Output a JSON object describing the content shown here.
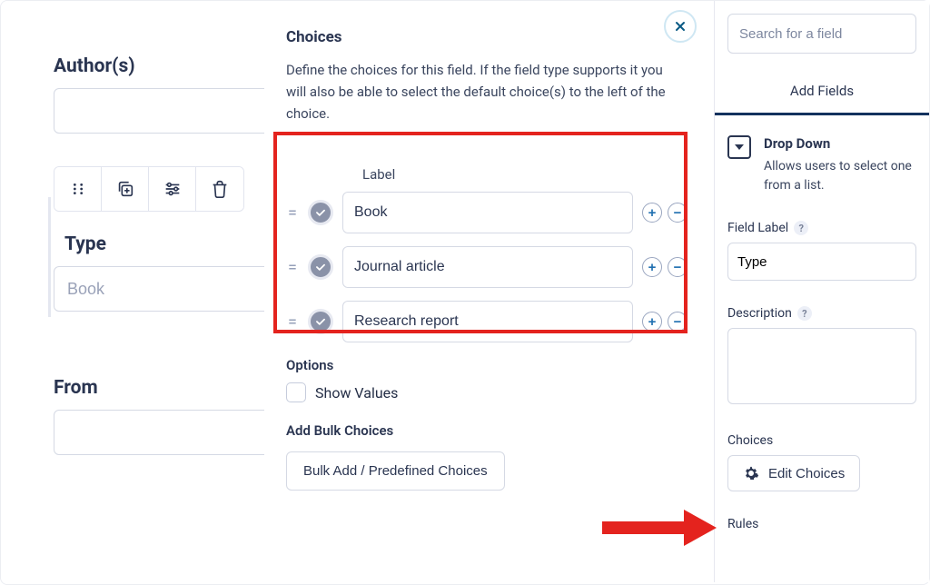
{
  "form": {
    "author_label": "Author(s)",
    "author_value": "",
    "type_label": "Type",
    "type_value": "Book",
    "from_label": "From",
    "from_value": ""
  },
  "modal": {
    "title": "Choices",
    "description": "Define the choices for this field. If the field type supports it you will also be able to select the default choice(s) to the left of the choice.",
    "label_header": "Label",
    "choices": [
      {
        "label": "Book"
      },
      {
        "label": "Journal article"
      },
      {
        "label": "Research report"
      }
    ],
    "options_heading": "Options",
    "show_values_label": "Show Values",
    "bulk_heading": "Add Bulk Choices",
    "bulk_button": "Bulk Add / Predefined Choices"
  },
  "side": {
    "search_placeholder": "Search for a field",
    "tab_add_fields": "Add Fields",
    "field_type_title": "Drop Down",
    "field_type_desc": "Allows users to select one from a list.",
    "field_label_heading": "Field Label",
    "field_label_value": "Type",
    "description_heading": "Description",
    "description_value": "",
    "choices_heading": "Choices",
    "edit_choices_label": "Edit Choices",
    "rules_heading": "Rules"
  }
}
